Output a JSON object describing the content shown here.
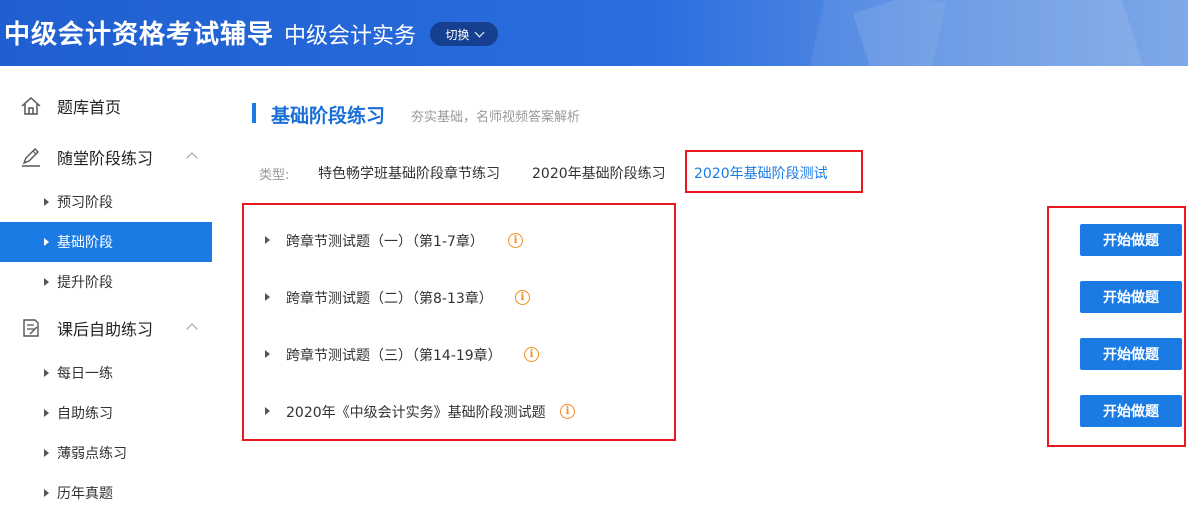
{
  "header": {
    "brand": "中级会计资格考试辅导",
    "subject": "中级会计实务",
    "switch_label": "切换"
  },
  "sidebar": {
    "home": "题库首页",
    "group1": {
      "label": "随堂阶段练习",
      "items": [
        "预习阶段",
        "基础阶段",
        "提升阶段"
      ]
    },
    "group2": {
      "label": "课后自助练习",
      "items": [
        "每日一练",
        "自助练习",
        "薄弱点练习",
        "历年真题"
      ]
    }
  },
  "main": {
    "title": "基础阶段练习",
    "subtitle": "夯实基础，名师视频答案解析",
    "type_label": "类型:",
    "type_tabs": [
      "特色畅学班基础阶段章节练习",
      "2020年基础阶段练习",
      "2020年基础阶段测试"
    ],
    "rows": [
      "跨章节测试题（一）（第1-7章）",
      "跨章节测试题（二）（第8-13章）",
      "跨章节测试题（三）（第14-19章）",
      "2020年《中级会计实务》基础阶段测试题"
    ],
    "start_label": "开始做题"
  },
  "colors": {
    "accent": "#1a7be5",
    "highlight_box": "#e8191e",
    "info": "#f08c1e"
  }
}
